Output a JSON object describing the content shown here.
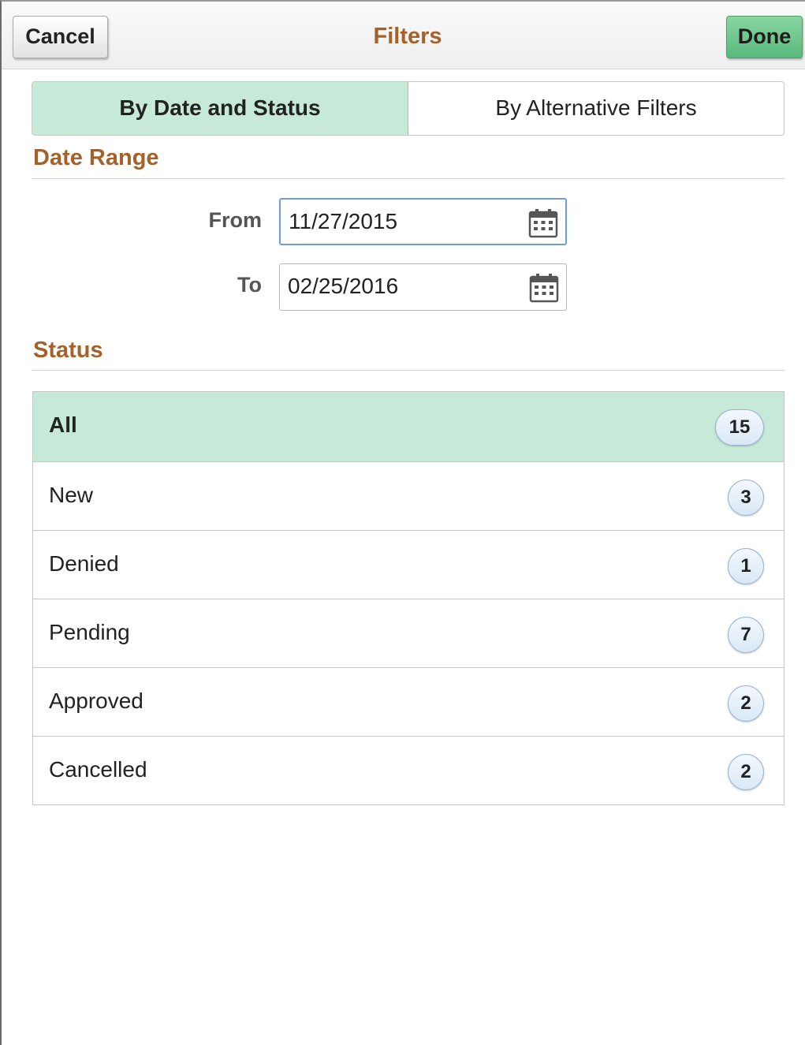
{
  "header": {
    "title": "Filters",
    "cancel_label": "Cancel",
    "done_label": "Done"
  },
  "tabs": [
    {
      "label": "By Date and Status",
      "active": true
    },
    {
      "label": "By Alternative Filters",
      "active": false
    }
  ],
  "date_range": {
    "heading": "Date Range",
    "from_label": "From",
    "from_value": "11/27/2015",
    "to_label": "To",
    "to_value": "02/25/2016",
    "calendar_icon": "calendar-icon"
  },
  "status": {
    "heading": "Status",
    "items": [
      {
        "label": "All",
        "count": "15",
        "selected": true
      },
      {
        "label": "New",
        "count": "3",
        "selected": false
      },
      {
        "label": "Denied",
        "count": "1",
        "selected": false
      },
      {
        "label": "Pending",
        "count": "7",
        "selected": false
      },
      {
        "label": "Approved",
        "count": "2",
        "selected": false
      },
      {
        "label": "Cancelled",
        "count": "2",
        "selected": false
      }
    ]
  },
  "colors": {
    "accent_title": "#a5612a",
    "selected_bg": "#c7ead8",
    "done_button": "#58b97b"
  }
}
